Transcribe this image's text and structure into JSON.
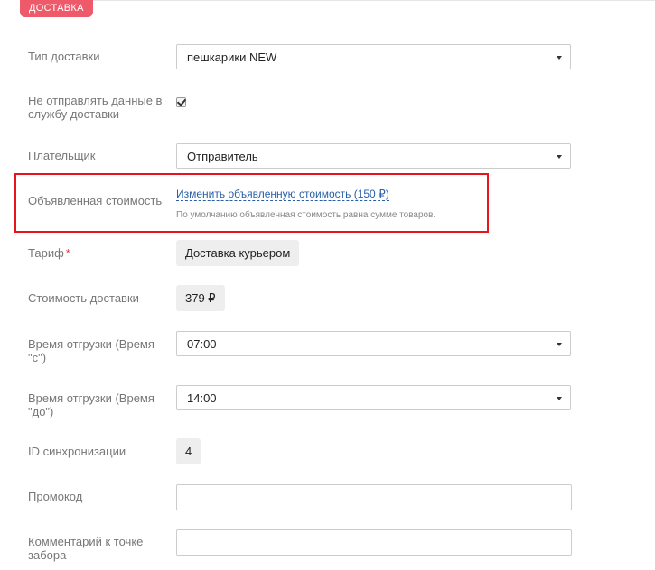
{
  "section": {
    "tab_label": "ДОСТАВКА"
  },
  "fields": {
    "delivery_type": {
      "label": "Тип доставки",
      "value": "пешкарики NEW"
    },
    "no_send": {
      "label": "Не отправлять данные в службу доставки",
      "checked": true
    },
    "payer": {
      "label": "Плательщик",
      "value": "Отправитель"
    },
    "declared_value": {
      "label": "Объявленная стоимость",
      "link": "Изменить объявленную стоимость (150 ₽)",
      "hint": "По умолчанию объявленная стоимость равна сумме товаров."
    },
    "tariff": {
      "label": "Тариф",
      "required_mark": "*",
      "value": "Доставка курьером"
    },
    "delivery_cost": {
      "label": "Стоимость доставки",
      "value": "379 ₽"
    },
    "ship_time_from": {
      "label": "Время отгрузки (Время \"с\")",
      "value": "07:00"
    },
    "ship_time_to": {
      "label": "Время отгрузки (Время \"до\")",
      "value": "14:00"
    },
    "sync_id": {
      "label": "ID синхронизации",
      "value": "4"
    },
    "promo": {
      "label": "Промокод",
      "value": ""
    },
    "pickup_comment": {
      "label": "Комментарий к точке забора",
      "value": ""
    }
  },
  "colors": {
    "accent": "#ef5a6b",
    "highlight": "#e8141c",
    "link": "#2a5fa8"
  }
}
